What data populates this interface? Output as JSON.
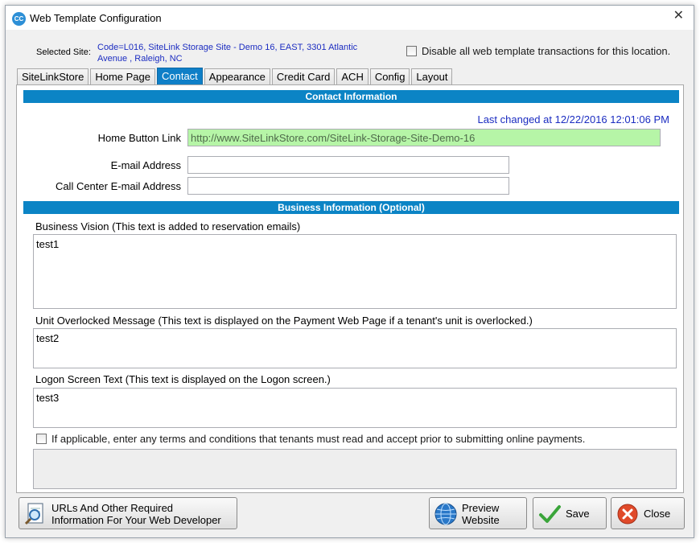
{
  "window": {
    "title": "Web Template Configuration",
    "icon_text": "CC",
    "close_glyph": "✕"
  },
  "site": {
    "label": "Selected  Site:",
    "value": "Code=L016,   SiteLink Storage Site - Demo 16, EAST, 3301 Atlantic Avenue , Raleigh, NC",
    "disable_label": "Disable all web template transactions for this location."
  },
  "tabs": [
    {
      "label": "SiteLinkStore",
      "active": false
    },
    {
      "label": "Home Page",
      "active": false
    },
    {
      "label": "Contact",
      "active": true
    },
    {
      "label": "Appearance",
      "active": false
    },
    {
      "label": "Credit Card",
      "active": false
    },
    {
      "label": "ACH",
      "active": false
    },
    {
      "label": "Config",
      "active": false
    },
    {
      "label": "Layout",
      "active": false
    }
  ],
  "contact": {
    "header": "Contact Information",
    "last_changed": "Last changed at 12/22/2016 12:01:06 PM",
    "home_link_label": "Home Button Link",
    "home_link_value": "http://www.SiteLinkStore.com/SiteLink-Storage-Site-Demo-16",
    "email_label": "E-mail Address",
    "email_value": "",
    "callcenter_label": "Call Center E-mail Address",
    "callcenter_value": ""
  },
  "business": {
    "header": "Business Information (Optional)",
    "vision_label": "Business Vision  (This text is added to reservation emails)",
    "vision_value": "test1",
    "overlock_label": "Unit Overlocked Message (This text is displayed on the Payment Web Page if a tenant's unit is overlocked.)",
    "overlock_value": "test2",
    "logon_label": "Logon Screen Text (This text is displayed on the Logon screen.)",
    "logon_value": "test3",
    "terms_label": "If applicable, enter any terms and conditions that tenants must read and accept prior to submitting online payments.",
    "terms_value": ""
  },
  "buttons": {
    "urls_label_1": "URLs And Other Required",
    "urls_label_2": "Information For Your Web Developer",
    "preview_label_1": "Preview",
    "preview_label_2": "Website",
    "save_label": "Save",
    "close_label": "Close"
  },
  "colors": {
    "accent": "#0b84c5",
    "link_blue": "#1b2cc1",
    "green_field": "#b6f5a7",
    "save_check": "#3aa53a",
    "close_red": "#e04a2a"
  }
}
